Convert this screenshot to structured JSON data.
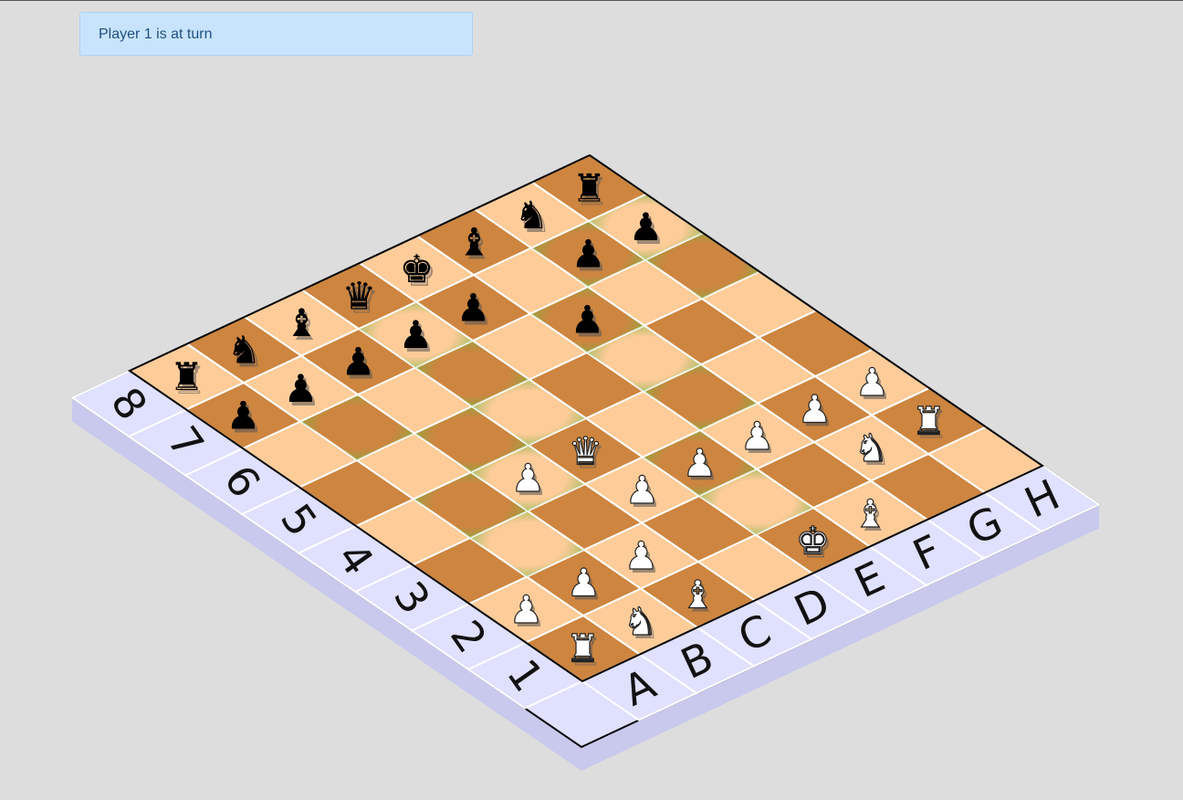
{
  "status": {
    "text": "Player 1 is at turn"
  },
  "board": {
    "files": [
      "A",
      "B",
      "C",
      "D",
      "E",
      "F",
      "G",
      "H"
    ],
    "ranks": [
      "1",
      "2",
      "3",
      "4",
      "5",
      "6",
      "7",
      "8"
    ],
    "highlighted_squares": [
      "b3",
      "c4",
      "d5",
      "b4",
      "c5",
      "d6",
      "b6",
      "d7",
      "e2",
      "e3",
      "f4",
      "f5",
      "f6",
      "g7",
      "h6",
      "h7"
    ],
    "pieces": [
      {
        "square": "a1",
        "color": "white",
        "type": "rook",
        "glyph": "♜"
      },
      {
        "square": "b1",
        "color": "white",
        "type": "knight",
        "glyph": "♞"
      },
      {
        "square": "c1",
        "color": "white",
        "type": "bishop",
        "glyph": "♝"
      },
      {
        "square": "a2",
        "color": "white",
        "type": "pawn",
        "glyph": "♟"
      },
      {
        "square": "b2",
        "color": "white",
        "type": "pawn",
        "glyph": "♟"
      },
      {
        "square": "c2",
        "color": "white",
        "type": "pawn",
        "glyph": "♟"
      },
      {
        "square": "e1",
        "color": "white",
        "type": "king",
        "glyph": "♚"
      },
      {
        "square": "f1",
        "color": "white",
        "type": "bishop",
        "glyph": "♝"
      },
      {
        "square": "d3",
        "color": "white",
        "type": "pawn",
        "glyph": "♟"
      },
      {
        "square": "e3",
        "color": "white",
        "type": "pawn",
        "glyph": "♟"
      },
      {
        "square": "f3",
        "color": "white",
        "type": "pawn",
        "glyph": "♟"
      },
      {
        "square": "g3",
        "color": "white",
        "type": "pawn",
        "glyph": "♟"
      },
      {
        "square": "h3",
        "color": "white",
        "type": "pawn",
        "glyph": "♟"
      },
      {
        "square": "g2",
        "color": "white",
        "type": "knight",
        "glyph": "♞"
      },
      {
        "square": "h2",
        "color": "white",
        "type": "rook",
        "glyph": "♜"
      },
      {
        "square": "d4",
        "color": "white",
        "type": "queen",
        "glyph": "♛"
      },
      {
        "square": "c4",
        "color": "white",
        "type": "pawn",
        "glyph": "♟"
      },
      {
        "square": "a8",
        "color": "black",
        "type": "rook",
        "glyph": "♜"
      },
      {
        "square": "b8",
        "color": "black",
        "type": "knight",
        "glyph": "♞"
      },
      {
        "square": "c8",
        "color": "black",
        "type": "bishop",
        "glyph": "♝"
      },
      {
        "square": "d8",
        "color": "black",
        "type": "queen",
        "glyph": "♛"
      },
      {
        "square": "e8",
        "color": "black",
        "type": "king",
        "glyph": "♚"
      },
      {
        "square": "f8",
        "color": "black",
        "type": "bishop",
        "glyph": "♝"
      },
      {
        "square": "g8",
        "color": "black",
        "type": "knight",
        "glyph": "♞"
      },
      {
        "square": "h8",
        "color": "black",
        "type": "rook",
        "glyph": "♜"
      },
      {
        "square": "a7",
        "color": "black",
        "type": "pawn",
        "glyph": "♟"
      },
      {
        "square": "b7",
        "color": "black",
        "type": "pawn",
        "glyph": "♟"
      },
      {
        "square": "c7",
        "color": "black",
        "type": "pawn",
        "glyph": "♟"
      },
      {
        "square": "d7",
        "color": "black",
        "type": "pawn",
        "glyph": "♟"
      },
      {
        "square": "e7",
        "color": "black",
        "type": "pawn",
        "glyph": "♟"
      },
      {
        "square": "g7",
        "color": "black",
        "type": "pawn",
        "glyph": "♟"
      },
      {
        "square": "h7",
        "color": "black",
        "type": "pawn",
        "glyph": "♟"
      },
      {
        "square": "f6",
        "color": "black",
        "type": "pawn",
        "glyph": "♟"
      }
    ]
  },
  "colors": {
    "light_square": "#fdcc99",
    "dark_square": "#cd853f",
    "highlight": "#7cb342",
    "border_frame": "#e0e0ff",
    "frame_side": "#c9c9ee",
    "white_piece": "#ffffff",
    "black_piece": "#000000"
  }
}
